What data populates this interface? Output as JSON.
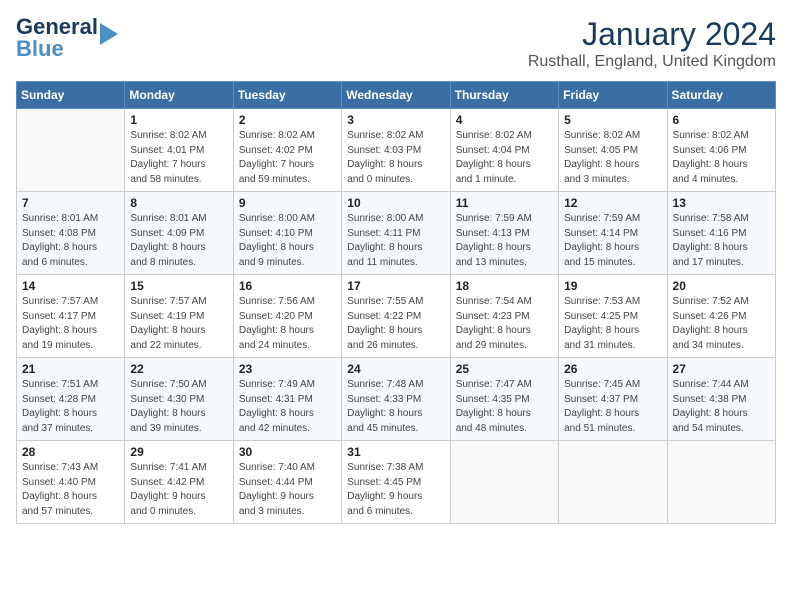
{
  "header": {
    "logo_line1": "General",
    "logo_line2": "Blue",
    "month": "January 2024",
    "location": "Rusthall, England, United Kingdom"
  },
  "weekdays": [
    "Sunday",
    "Monday",
    "Tuesday",
    "Wednesday",
    "Thursday",
    "Friday",
    "Saturday"
  ],
  "weeks": [
    [
      {
        "day": "",
        "info": ""
      },
      {
        "day": "1",
        "info": "Sunrise: 8:02 AM\nSunset: 4:01 PM\nDaylight: 7 hours\nand 58 minutes."
      },
      {
        "day": "2",
        "info": "Sunrise: 8:02 AM\nSunset: 4:02 PM\nDaylight: 7 hours\nand 59 minutes."
      },
      {
        "day": "3",
        "info": "Sunrise: 8:02 AM\nSunset: 4:03 PM\nDaylight: 8 hours\nand 0 minutes."
      },
      {
        "day": "4",
        "info": "Sunrise: 8:02 AM\nSunset: 4:04 PM\nDaylight: 8 hours\nand 1 minute."
      },
      {
        "day": "5",
        "info": "Sunrise: 8:02 AM\nSunset: 4:05 PM\nDaylight: 8 hours\nand 3 minutes."
      },
      {
        "day": "6",
        "info": "Sunrise: 8:02 AM\nSunset: 4:06 PM\nDaylight: 8 hours\nand 4 minutes."
      }
    ],
    [
      {
        "day": "7",
        "info": "Sunrise: 8:01 AM\nSunset: 4:08 PM\nDaylight: 8 hours\nand 6 minutes."
      },
      {
        "day": "8",
        "info": "Sunrise: 8:01 AM\nSunset: 4:09 PM\nDaylight: 8 hours\nand 8 minutes."
      },
      {
        "day": "9",
        "info": "Sunrise: 8:00 AM\nSunset: 4:10 PM\nDaylight: 8 hours\nand 9 minutes."
      },
      {
        "day": "10",
        "info": "Sunrise: 8:00 AM\nSunset: 4:11 PM\nDaylight: 8 hours\nand 11 minutes."
      },
      {
        "day": "11",
        "info": "Sunrise: 7:59 AM\nSunset: 4:13 PM\nDaylight: 8 hours\nand 13 minutes."
      },
      {
        "day": "12",
        "info": "Sunrise: 7:59 AM\nSunset: 4:14 PM\nDaylight: 8 hours\nand 15 minutes."
      },
      {
        "day": "13",
        "info": "Sunrise: 7:58 AM\nSunset: 4:16 PM\nDaylight: 8 hours\nand 17 minutes."
      }
    ],
    [
      {
        "day": "14",
        "info": "Sunrise: 7:57 AM\nSunset: 4:17 PM\nDaylight: 8 hours\nand 19 minutes."
      },
      {
        "day": "15",
        "info": "Sunrise: 7:57 AM\nSunset: 4:19 PM\nDaylight: 8 hours\nand 22 minutes."
      },
      {
        "day": "16",
        "info": "Sunrise: 7:56 AM\nSunset: 4:20 PM\nDaylight: 8 hours\nand 24 minutes."
      },
      {
        "day": "17",
        "info": "Sunrise: 7:55 AM\nSunset: 4:22 PM\nDaylight: 8 hours\nand 26 minutes."
      },
      {
        "day": "18",
        "info": "Sunrise: 7:54 AM\nSunset: 4:23 PM\nDaylight: 8 hours\nand 29 minutes."
      },
      {
        "day": "19",
        "info": "Sunrise: 7:53 AM\nSunset: 4:25 PM\nDaylight: 8 hours\nand 31 minutes."
      },
      {
        "day": "20",
        "info": "Sunrise: 7:52 AM\nSunset: 4:26 PM\nDaylight: 8 hours\nand 34 minutes."
      }
    ],
    [
      {
        "day": "21",
        "info": "Sunrise: 7:51 AM\nSunset: 4:28 PM\nDaylight: 8 hours\nand 37 minutes."
      },
      {
        "day": "22",
        "info": "Sunrise: 7:50 AM\nSunset: 4:30 PM\nDaylight: 8 hours\nand 39 minutes."
      },
      {
        "day": "23",
        "info": "Sunrise: 7:49 AM\nSunset: 4:31 PM\nDaylight: 8 hours\nand 42 minutes."
      },
      {
        "day": "24",
        "info": "Sunrise: 7:48 AM\nSunset: 4:33 PM\nDaylight: 8 hours\nand 45 minutes."
      },
      {
        "day": "25",
        "info": "Sunrise: 7:47 AM\nSunset: 4:35 PM\nDaylight: 8 hours\nand 48 minutes."
      },
      {
        "day": "26",
        "info": "Sunrise: 7:45 AM\nSunset: 4:37 PM\nDaylight: 8 hours\nand 51 minutes."
      },
      {
        "day": "27",
        "info": "Sunrise: 7:44 AM\nSunset: 4:38 PM\nDaylight: 8 hours\nand 54 minutes."
      }
    ],
    [
      {
        "day": "28",
        "info": "Sunrise: 7:43 AM\nSunset: 4:40 PM\nDaylight: 8 hours\nand 57 minutes."
      },
      {
        "day": "29",
        "info": "Sunrise: 7:41 AM\nSunset: 4:42 PM\nDaylight: 9 hours\nand 0 minutes."
      },
      {
        "day": "30",
        "info": "Sunrise: 7:40 AM\nSunset: 4:44 PM\nDaylight: 9 hours\nand 3 minutes."
      },
      {
        "day": "31",
        "info": "Sunrise: 7:38 AM\nSunset: 4:45 PM\nDaylight: 9 hours\nand 6 minutes."
      },
      {
        "day": "",
        "info": ""
      },
      {
        "day": "",
        "info": ""
      },
      {
        "day": "",
        "info": ""
      }
    ]
  ]
}
